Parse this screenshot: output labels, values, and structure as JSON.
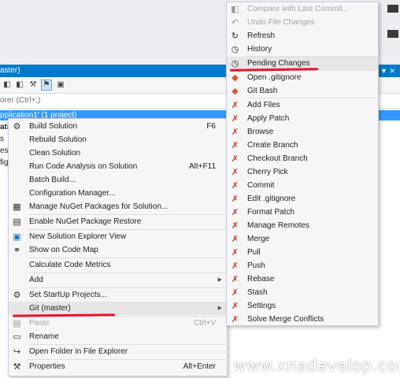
{
  "background": {
    "title_fragment": "aster)",
    "search_fragment": "orer (Ctrl+;)",
    "selected_row_fragment": "pplication1' (1 project)",
    "clipped_lines": [
      "atio",
      "s",
      "es",
      "fig"
    ]
  },
  "context_menu": {
    "items": [
      {
        "label": "Build Solution",
        "shortcut": "F6",
        "icon": "build-icon"
      },
      {
        "label": "Rebuild Solution",
        "shortcut": "",
        "icon": ""
      },
      {
        "label": "Clean Solution",
        "shortcut": "",
        "icon": ""
      },
      {
        "label": "Run Code Analysis on Solution",
        "shortcut": "Alt+F11",
        "icon": ""
      },
      {
        "label": "Batch Build...",
        "shortcut": "",
        "icon": ""
      },
      {
        "label": "Configuration Manager...",
        "shortcut": "",
        "icon": ""
      },
      {
        "label": "Manage NuGet Packages for Solution...",
        "shortcut": "",
        "icon": "nuget-icon"
      },
      {
        "label": "Enable NuGet Package Restore",
        "shortcut": "",
        "icon": "package-icon"
      },
      {
        "label": "New Solution Explorer View",
        "shortcut": "",
        "icon": "new-view-icon"
      },
      {
        "label": "Show on Code Map",
        "shortcut": "",
        "icon": "code-map-icon"
      },
      {
        "label": "Calculate Code Metrics",
        "shortcut": "",
        "icon": ""
      },
      {
        "label": "Add",
        "shortcut": "",
        "icon": ""
      },
      {
        "label": "Set StartUp Projects...",
        "shortcut": "",
        "icon": "gear-icon"
      },
      {
        "label": "Git (master)",
        "shortcut": "",
        "icon": ""
      },
      {
        "label": "Paste",
        "shortcut": "Ctrl+V",
        "icon": "paste-icon"
      },
      {
        "label": "Rename",
        "shortcut": "",
        "icon": "rename-icon"
      },
      {
        "label": "Open Folder in File Explorer",
        "shortcut": "",
        "icon": "open-folder-icon"
      },
      {
        "label": "Properties",
        "shortcut": "Alt+Enter",
        "icon": "wrench-icon"
      }
    ]
  },
  "git_menu": {
    "items": [
      {
        "label": "Compare with Last Commit...",
        "icon": "compare-icon"
      },
      {
        "label": "Undo File Changes",
        "icon": "undo-icon"
      },
      {
        "label": "Refresh",
        "icon": "refresh-icon"
      },
      {
        "label": "History",
        "icon": "history-icon"
      },
      {
        "label": "Pending Changes",
        "icon": "pending-changes-icon"
      },
      {
        "label": "Open .gitignore",
        "icon": "git-icon"
      },
      {
        "label": "Git Bash",
        "icon": "git-icon"
      },
      {
        "label": "Add Files",
        "icon": "git-ext-icon"
      },
      {
        "label": "Apply Patch",
        "icon": "git-ext-icon"
      },
      {
        "label": "Browse",
        "icon": "git-ext-icon"
      },
      {
        "label": "Create Branch",
        "icon": "git-ext-icon"
      },
      {
        "label": "Checkout Branch",
        "icon": "git-ext-icon"
      },
      {
        "label": "Cherry Pick",
        "icon": "git-ext-icon"
      },
      {
        "label": "Commit",
        "icon": "git-ext-icon"
      },
      {
        "label": "Edit .gitignore",
        "icon": "git-ext-icon"
      },
      {
        "label": "Format Patch",
        "icon": "git-ext-icon"
      },
      {
        "label": "Manage Remotes",
        "icon": "git-ext-icon"
      },
      {
        "label": "Merge",
        "icon": "git-ext-icon"
      },
      {
        "label": "Pull",
        "icon": "git-ext-icon"
      },
      {
        "label": "Push",
        "icon": "git-ext-icon"
      },
      {
        "label": "Rebase",
        "icon": "git-ext-icon"
      },
      {
        "label": "Stash",
        "icon": "git-ext-icon"
      },
      {
        "label": "Settings",
        "icon": "git-ext-icon"
      },
      {
        "label": "Solve Merge Conflicts",
        "icon": "git-ext-icon"
      }
    ]
  },
  "watermark": "www.xnadevelop.com",
  "colors": {
    "accent": "#007acc",
    "selection": "#3399ff",
    "annotation_underline": "#e8132a",
    "git_icon": "#c0392b"
  }
}
